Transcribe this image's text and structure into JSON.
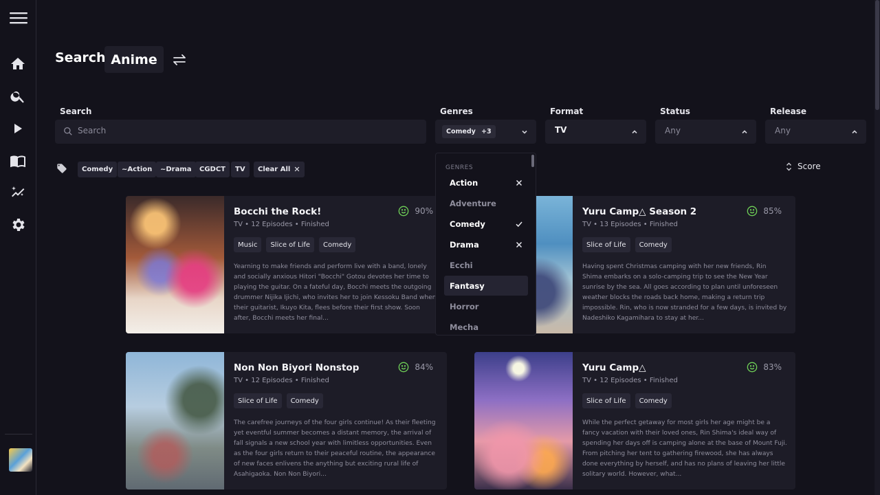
{
  "header": {
    "title": "Search",
    "media_type": "Anime"
  },
  "filters": {
    "search": {
      "label": "Search",
      "placeholder": "Search"
    },
    "genres": {
      "label": "Genres",
      "selected_chip": "Comedy",
      "more_chip": "+3"
    },
    "format": {
      "label": "Format",
      "value": "TV"
    },
    "status": {
      "label": "Status",
      "value": "Any"
    },
    "release": {
      "label": "Release",
      "value": "Any"
    }
  },
  "active_tags": [
    "Comedy",
    "~Action",
    "~Drama",
    "CGDCT",
    "TV"
  ],
  "clear_all": "Clear All",
  "sort": {
    "label": "Score"
  },
  "genre_dropdown": {
    "header": "GENRES",
    "options": [
      {
        "label": "Action",
        "state": "excluded"
      },
      {
        "label": "Adventure",
        "state": "none"
      },
      {
        "label": "Comedy",
        "state": "included"
      },
      {
        "label": "Drama",
        "state": "excluded"
      },
      {
        "label": "Ecchi",
        "state": "none"
      },
      {
        "label": "Fantasy",
        "state": "hover"
      },
      {
        "label": "Horror",
        "state": "none"
      },
      {
        "label": "Mecha",
        "state": "none"
      }
    ]
  },
  "results": [
    {
      "title": "Bocchi the Rock!",
      "meta": "TV • 12 Episodes • Finished",
      "score": "90%",
      "genres": [
        "Music",
        "Slice of Life",
        "Comedy"
      ],
      "description": "Yearning to make friends and perform live with a band, lonely and socially anxious Hitori \"Bocchi\" Gotou devotes her time to playing the guitar. On a fateful day, Bocchi meets the outgoing drummer Nijika Ijichi, who invites her to join Kessoku Band when their guitarist, Ikuyo Kita, flees before their first show. Soon after, Bocchi meets her final..."
    },
    {
      "title": "Yuru Camp△ Season 2",
      "meta": "TV • 13 Episodes • Finished",
      "score": "85%",
      "genres": [
        "Slice of Life",
        "Comedy"
      ],
      "description": "Having spent Christmas camping with her new friends, Rin Shima embarks on a solo-camping trip to see the New Year sunrise by the sea. All goes according to plan until unforeseen weather blocks the roads back home, making a return trip impossible. Rin, who is now stranded for a few days, is invited by Nadeshiko Kagamihara to stay at her..."
    },
    {
      "title": "Non Non Biyori Nonstop",
      "meta": "TV • 12 Episodes • Finished",
      "score": "84%",
      "genres": [
        "Slice of Life",
        "Comedy"
      ],
      "description": "The carefree journeys of the four girls continue! As their fleeting yet eventful summer becomes a distant memory, the arrival of fall signals a new school year with limitless opportunities. Even as the four girls return to their peaceful routine, the appearance of new faces enlivens the anything but exciting rural life of Asahigaoka. Non Non Biyori..."
    },
    {
      "title": "Yuru Camp△",
      "meta": "TV • 12 Episodes • Finished",
      "score": "83%",
      "genres": [
        "Slice of Life",
        "Comedy"
      ],
      "description": "While the perfect getaway for most girls her age might be a fancy vacation with their loved ones, Rin Shima's ideal way of spending her days off is camping alone at the base of Mount Fuji. From pitching her tent to gathering firewood, she has always done everything by herself, and has no plans of leaving her little solitary world. However, what..."
    }
  ],
  "colors": {
    "background": "#13121b",
    "card": "#1d1c27",
    "score_green": "#6fd057"
  }
}
